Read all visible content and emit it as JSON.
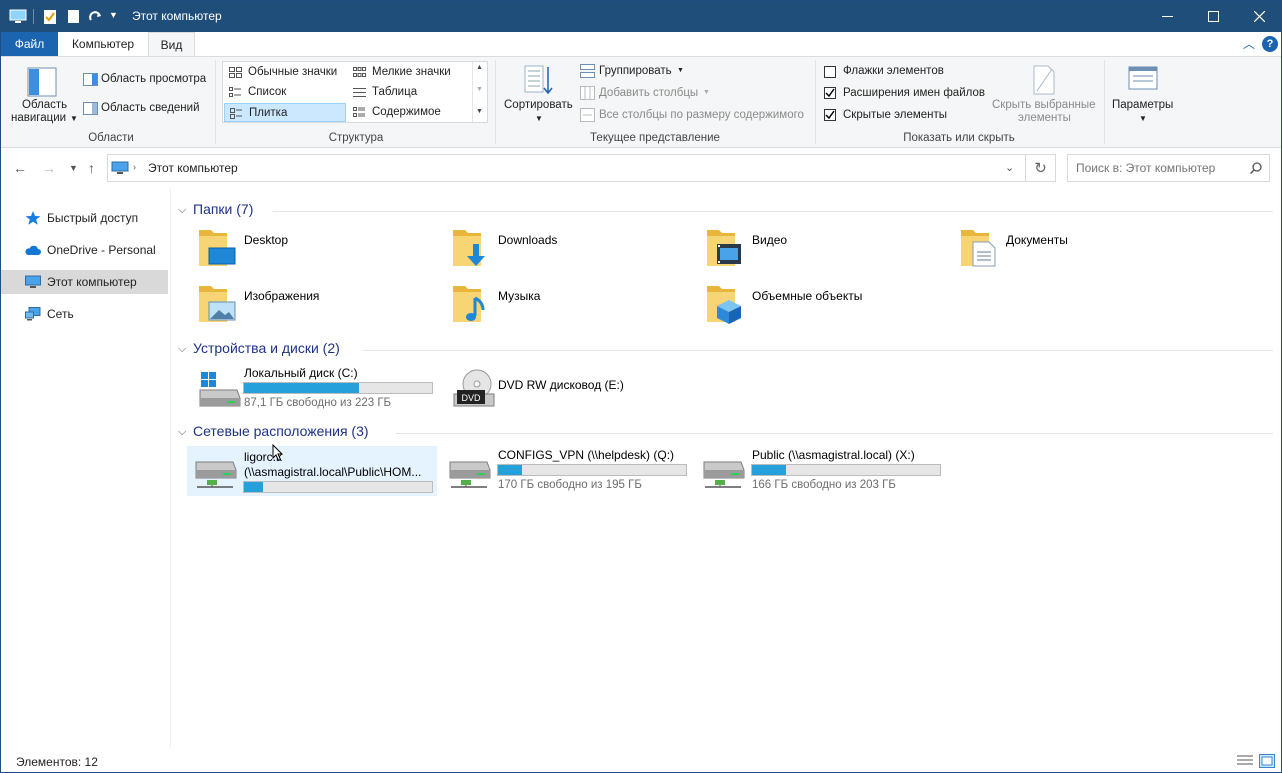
{
  "window": {
    "title": "Этот компьютер"
  },
  "ribbon_tabs": [
    "Файл",
    "Компьютер",
    "Вид"
  ],
  "ribbon": {
    "panes": {
      "nav_pane_label_1": "Область",
      "nav_pane_label_2": "навигации",
      "preview_pane": "Область просмотра",
      "details_pane": "Область сведений",
      "group": "Области"
    },
    "layout": {
      "items": [
        "Обычные значки",
        "Мелкие значки",
        "Список",
        "Таблица",
        "Плитка",
        "Содержимое"
      ],
      "selected": "Плитка",
      "group": "Структура"
    },
    "current_view": {
      "sort": "Сортировать",
      "group_by": "Группировать",
      "add_columns": "Добавить столбцы",
      "size_columns": "Все столбцы по размеру содержимого",
      "group": "Текущее представление"
    },
    "show_hide": {
      "item_checkboxes": "Флажки элементов",
      "item_checkboxes_checked": false,
      "file_extensions": "Расширения имен файлов",
      "file_extensions_checked": true,
      "hidden_items": "Скрытые элементы",
      "hidden_items_checked": true,
      "hide_selected_1": "Скрыть выбранные",
      "hide_selected_2": "элементы",
      "group": "Показать или скрыть"
    },
    "options": "Параметры"
  },
  "address": {
    "path": "Этот компьютер",
    "search_placeholder": "Поиск в: Этот компьютер"
  },
  "nav": {
    "items": [
      "Быстрый доступ",
      "OneDrive - Personal",
      "Этот компьютер",
      "Сеть"
    ],
    "selected": "Этот компьютер"
  },
  "sections": {
    "folders": {
      "title": "Папки (7)",
      "items": [
        "Desktop",
        "Downloads",
        "Видео",
        "Документы",
        "Изображения",
        "Музыка",
        "Объемные объекты"
      ]
    },
    "drives": {
      "title": "Устройства и диски (2)",
      "items": [
        {
          "name": "Локальный диск (C:)",
          "free": "87,1 ГБ свободно из 223 ГБ",
          "used_fraction": 0.61
        },
        {
          "name": "DVD RW дисковод (E:)",
          "badge": "DVD"
        }
      ]
    },
    "network": {
      "title": "Сетевые расположения (3)",
      "items": [
        {
          "name_line1": "ligorc.k",
          "name_line2": "(\\\\asmagistral.local\\Public\\HOM...",
          "used_fraction": 0.1
        },
        {
          "name": "CONFIGS_VPN (\\\\helpdesk) (Q:)",
          "free": "170 ГБ свободно из 195 ГБ",
          "used_fraction": 0.13
        },
        {
          "name": "Public (\\\\asmagistral.local) (X:)",
          "free": "166 ГБ свободно из 203 ГБ",
          "used_fraction": 0.18
        }
      ]
    }
  },
  "status": {
    "count": "Элементов: 12"
  },
  "colors": {
    "titlebar": "#1f4e7a",
    "file_tab": "#1a64b0",
    "section_title": "#1e3287",
    "bar_fill": "#26a0da",
    "selection": "#cce8ff"
  }
}
